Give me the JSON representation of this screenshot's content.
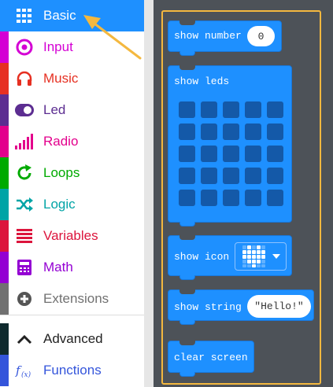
{
  "toolbox": {
    "categories": [
      {
        "id": "basic",
        "label": "Basic",
        "color": "#1E90FF",
        "icon": "grid-icon"
      },
      {
        "id": "input",
        "label": "Input",
        "color": "#D400D4",
        "icon": "target-icon"
      },
      {
        "id": "music",
        "label": "Music",
        "color": "#E63022",
        "icon": "headphones-icon"
      },
      {
        "id": "led",
        "label": "Led",
        "color": "#5C2D91",
        "icon": "toggle-icon"
      },
      {
        "id": "radio",
        "label": "Radio",
        "color": "#E3008C",
        "icon": "signal-bars-icon"
      },
      {
        "id": "loops",
        "label": "Loops",
        "color": "#00AA00",
        "icon": "refresh-icon"
      },
      {
        "id": "logic",
        "label": "Logic",
        "color": "#00A4A6",
        "icon": "shuffle-icon"
      },
      {
        "id": "variables",
        "label": "Variables",
        "color": "#DC143C",
        "icon": "list-icon"
      },
      {
        "id": "math",
        "label": "Math",
        "color": "#9400D3",
        "icon": "calculator-icon"
      },
      {
        "id": "extensions",
        "label": "Extensions",
        "color": "#717171",
        "icon": "plus-circle-icon"
      },
      {
        "id": "advanced",
        "label": "Advanced",
        "color": "#222222",
        "icon": "chevron-up-icon"
      },
      {
        "id": "functions",
        "label": "Functions",
        "color": "#3455DB",
        "icon": "function-icon"
      }
    ]
  },
  "flyout": {
    "show_number": {
      "label": "show number",
      "value": "0"
    },
    "show_leds": {
      "label": "show leds"
    },
    "show_icon": {
      "label": "show icon",
      "icon": "heart-icon"
    },
    "show_string": {
      "label": "show string",
      "value": "\"Hello!\""
    },
    "clear_screen": {
      "label": "clear screen"
    }
  },
  "colors": {
    "block": "#1E90FF",
    "flyout_bg": "#4D5258",
    "flyout_border": "#F4B83F",
    "arrow": "#F4B83F"
  }
}
